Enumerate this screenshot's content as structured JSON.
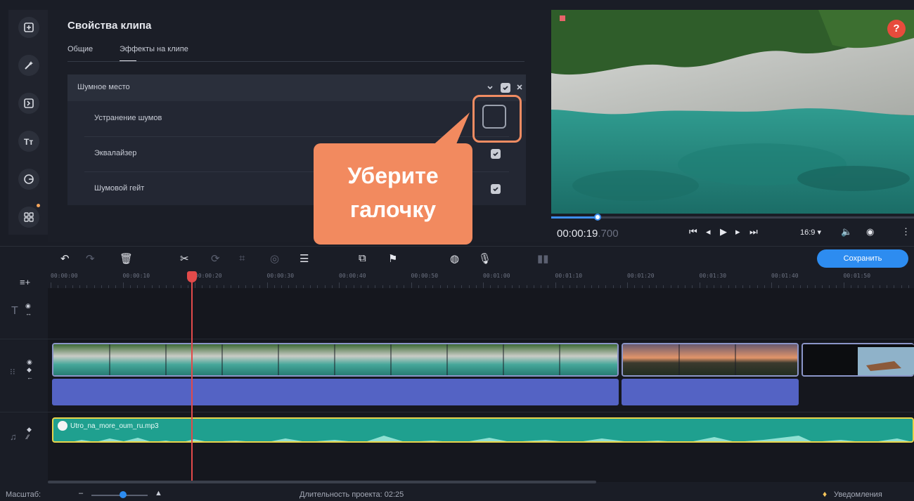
{
  "panel": {
    "title": "Свойства клипа",
    "tabs": [
      {
        "label": "Общие"
      },
      {
        "label": "Эффекты на клипе"
      }
    ]
  },
  "effect": {
    "name": "Шумное место",
    "rows": [
      {
        "label": "Устранение шумов",
        "checked": false
      },
      {
        "label": "Эквалайзер",
        "checked": true
      },
      {
        "label": "Шумовой гейт",
        "checked": true
      }
    ]
  },
  "callout": {
    "text": "Уберите\nгалочку"
  },
  "preview": {
    "timecode_main": "00:00:19",
    "timecode_ms": ".700",
    "aspect": "16:9",
    "help": "?",
    "progress": 0.13
  },
  "toolbar": {
    "save_label": "Сохранить"
  },
  "ruler": {
    "labels": [
      "00:00:00",
      "00:00:10",
      "00:00:20",
      "00:00:30",
      "00:00:40",
      "00:00:50",
      "00:01:00",
      "00:01:10",
      "00:01:20",
      "00:01:30",
      "00:01:40",
      "00:01:50"
    ]
  },
  "music": {
    "file": "Utro_na_more_oum_ru.mp3"
  },
  "status": {
    "zoom_label": "Масштаб:",
    "duration": "Длительность проекта: 02:25",
    "notifications": "Уведомления"
  },
  "colors": {
    "accent": "#2d8cf0",
    "callout": "#f28a5f",
    "playhead": "#e24a4a",
    "music_clip": "#1fa08f",
    "audio_clip": "#5463c4"
  }
}
